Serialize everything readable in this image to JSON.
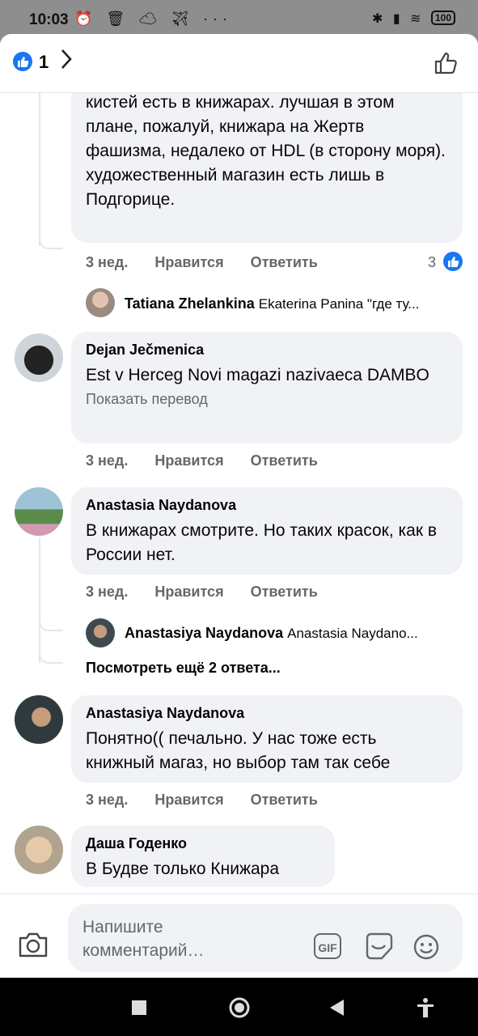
{
  "status_bar": {
    "time": "10:03",
    "left_icons": "⏰ 🗑 ☁ ✈ ···",
    "right_icons": "✱ ▮ ≋",
    "battery": "100"
  },
  "header": {
    "like_count": "1",
    "icons": [
      "like-reaction-icon",
      "chevron-right-icon",
      "thumbs-up-outline-icon"
    ]
  },
  "comments": [
    {
      "text": "кистей есть в книжарах. лучшая в этом плане, пожалуй, книжара на Жертв фашизма, недалеко от HDL (в сторону моря).\nхудожественный магазин есть лишь в Подгорице.",
      "time": "3 нед.",
      "like": "Нравится",
      "reply": "Ответить",
      "reactions": "3",
      "reply_preview": {
        "author": "Tatiana Zhelankina",
        "text": "Ekaterina Panina \"где ту..."
      }
    },
    {
      "author": "Dejan Ječmenica",
      "text": "Est v Herceg Novi magazi nazivaeca DAMBO",
      "translate": "Показать перевод",
      "time": "3 нед.",
      "like": "Нравится",
      "reply": "Ответить"
    },
    {
      "author": "Anastasia Naydanova",
      "text": "В книжарах смотрите. Но таких красок, как в России нет.",
      "time": "3 нед.",
      "like": "Нравится",
      "reply": "Ответить",
      "reply_preview": {
        "author": "Anastasiya Naydanova",
        "text": "Anastasia Naydano..."
      },
      "more_replies": "Посмотреть ещё 2 ответа..."
    },
    {
      "author": "Anastasiya Naydanova",
      "text": "Понятно(( печально. У нас тоже есть книжный магаз, но выбор там так себе",
      "time": "3 нед.",
      "like": "Нравится",
      "reply": "Ответить"
    },
    {
      "author": "Даша Годенко",
      "text": "В Будве только Книжара"
    }
  ],
  "composer": {
    "placeholder": "Напишите комментарий…",
    "gif_label": "GIF",
    "icons": [
      "camera-icon",
      "gif-icon",
      "sticker-icon",
      "emoji-icon"
    ]
  },
  "nav": {
    "icons": [
      "recents-square-icon",
      "home-circle-icon",
      "back-triangle-icon",
      "accessibility-icon"
    ]
  },
  "colors": {
    "accent": "#1877f2",
    "bubble": "#f0f2f5",
    "secondary_text": "#65676b"
  }
}
